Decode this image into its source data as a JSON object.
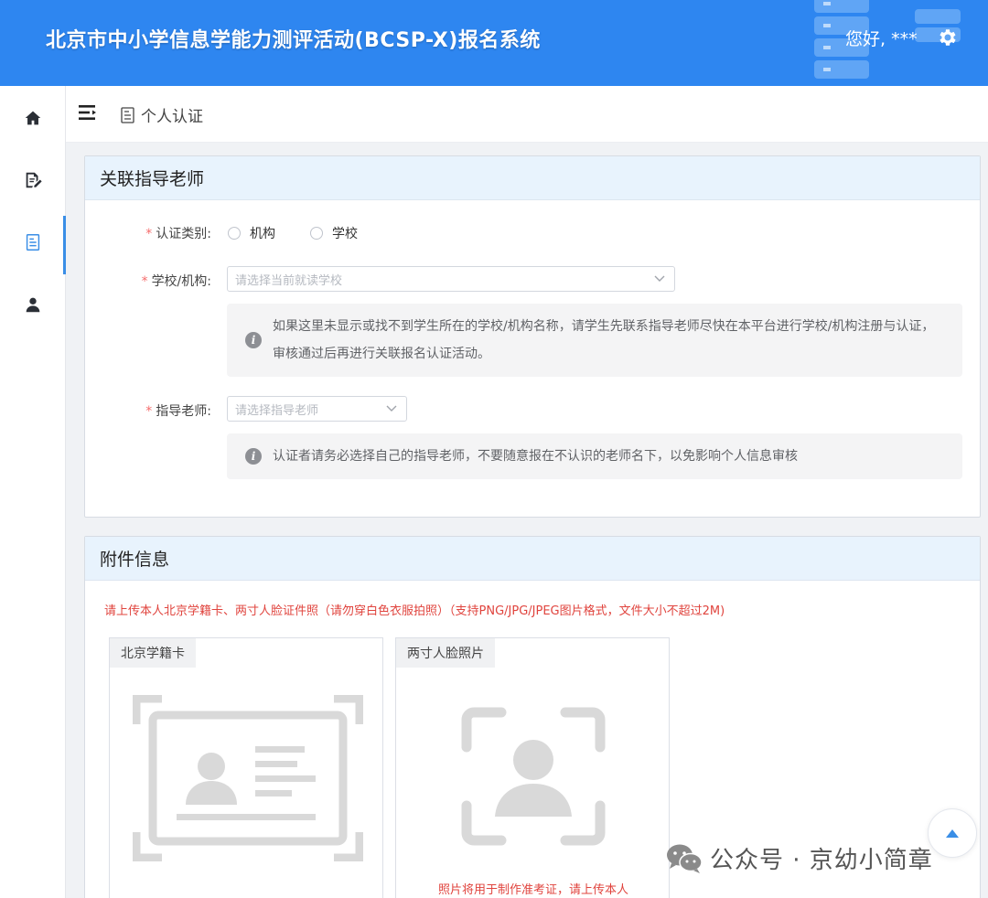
{
  "header": {
    "title": "北京市中小学信息学能力测评活动(BCSP-X)报名系统",
    "greeting": "您好, ***",
    "settings_icon": "gear-icon",
    "bg_color": "#2e86f0"
  },
  "sidebar": {
    "items": [
      {
        "name": "home",
        "icon": "home-icon",
        "active": false
      },
      {
        "name": "sign-up",
        "icon": "edit-document-icon",
        "active": false
      },
      {
        "name": "certification",
        "icon": "document-icon",
        "active": true
      },
      {
        "name": "profile",
        "icon": "user-icon",
        "active": false
      }
    ]
  },
  "breadcrumb": {
    "toggle_icon": "menu-fold-icon",
    "page_icon": "document-icon",
    "label": "个人认证"
  },
  "teacher_panel": {
    "title": "关联指导老师",
    "cert_type": {
      "label": "认证类别:",
      "required_mark": "*",
      "options": [
        "机构",
        "学校"
      ]
    },
    "school": {
      "label": "学校/机构:",
      "required_mark": "*",
      "placeholder": "请选择当前就读学校"
    },
    "school_tip": "如果这里未显示或找不到学生所在的学校/机构名称，请学生先联系指导老师尽快在本平台进行学校/机构注册与认证，审核通过后再进行关联报名认证活动。",
    "teacher": {
      "label": "指导老师:",
      "required_mark": "*",
      "placeholder": "请选择指导老师"
    },
    "teacher_tip": "认证者请务必选择自己的指导老师，不要随意报在不认识的老师名下，以免影响个人信息审核"
  },
  "attachment_panel": {
    "title": "附件信息",
    "notice": "请上传本人北京学籍卡、两寸人脸证件照（请勿穿白色衣服拍照）（支持PNG/JPG/JPEG图片格式，文件大小不超过2M)",
    "cards": [
      {
        "tag": "北京学籍卡",
        "icon": "id-card-icon",
        "hint": ""
      },
      {
        "tag": "两寸人脸照片",
        "icon": "face-scan-icon",
        "hint": "照片将用于制作准考证，请上传本人"
      }
    ]
  },
  "watermark": {
    "icon": "wechat-icon",
    "text": "公众号 · 京幼小简章"
  },
  "back_to_top": {
    "icon": "caret-up-icon"
  },
  "colors": {
    "accent": "#3a8ee6",
    "required": "#f56c6c",
    "notice": "#e0443e",
    "panel_head": "#e8f3fd"
  }
}
